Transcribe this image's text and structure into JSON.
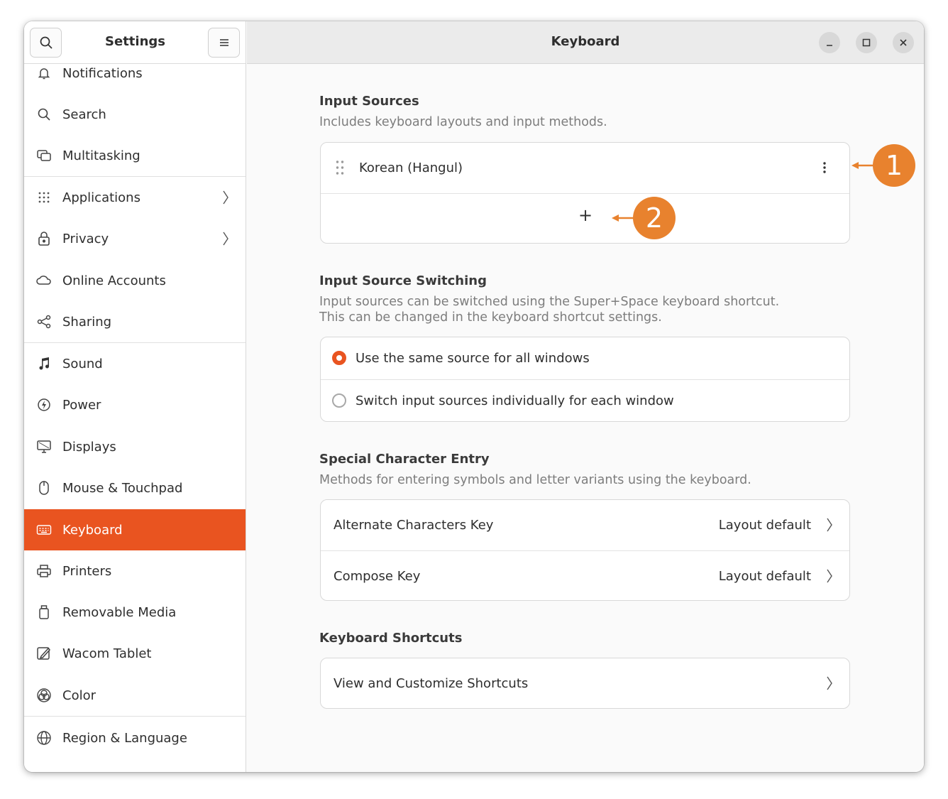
{
  "sidebar": {
    "title": "Settings",
    "search_icon": "search-icon",
    "menu_icon": "hamburger-menu-icon",
    "items": [
      {
        "label": "Notifications",
        "icon": "bell-icon"
      },
      {
        "label": "Search",
        "icon": "search-icon"
      },
      {
        "label": "Multitasking",
        "icon": "multitasking-icon"
      },
      {
        "label": "Applications",
        "icon": "apps-grid-icon"
      },
      {
        "label": "Privacy",
        "icon": "lock-icon"
      },
      {
        "label": "Online Accounts",
        "icon": "cloud-icon"
      },
      {
        "label": "Sharing",
        "icon": "share-icon"
      },
      {
        "label": "Sound",
        "icon": "music-note-icon"
      },
      {
        "label": "Power",
        "icon": "power-icon"
      },
      {
        "label": "Displays",
        "icon": "display-icon"
      },
      {
        "label": "Mouse & Touchpad",
        "icon": "mouse-icon"
      },
      {
        "label": "Keyboard",
        "icon": "keyboard-icon",
        "active": true
      },
      {
        "label": "Printers",
        "icon": "printer-icon"
      },
      {
        "label": "Removable Media",
        "icon": "removable-media-icon"
      },
      {
        "label": "Wacom Tablet",
        "icon": "tablet-icon"
      },
      {
        "label": "Color",
        "icon": "color-icon"
      },
      {
        "label": "Region & Language",
        "icon": "globe-icon"
      }
    ]
  },
  "header": {
    "title": "Keyboard",
    "minimize_icon": "minimize-icon",
    "maximize_icon": "maximize-icon",
    "close_icon": "close-icon"
  },
  "input_sources": {
    "title": "Input Sources",
    "description": "Includes keyboard layouts and input methods.",
    "sources": [
      {
        "label": "Korean (Hangul)"
      }
    ],
    "add_label": "+"
  },
  "switching": {
    "title": "Input Source Switching",
    "description_line1": "Input sources can be switched using the Super+Space keyboard shortcut.",
    "description_line2": "This can be changed in the keyboard shortcut settings.",
    "options": [
      {
        "label": "Use the same source for all windows",
        "selected": true
      },
      {
        "label": "Switch input sources individually for each window",
        "selected": false
      }
    ]
  },
  "special": {
    "title": "Special Character Entry",
    "description": "Methods for entering symbols and letter variants using the keyboard.",
    "rows": [
      {
        "label": "Alternate Characters Key",
        "value": "Layout default"
      },
      {
        "label": "Compose Key",
        "value": "Layout default"
      }
    ]
  },
  "shortcuts": {
    "title": "Keyboard Shortcuts",
    "row_label": "View and Customize Shortcuts"
  },
  "callouts": [
    "1",
    "2"
  ],
  "colors": {
    "accent": "#e95420",
    "callout": "#e8822e"
  }
}
